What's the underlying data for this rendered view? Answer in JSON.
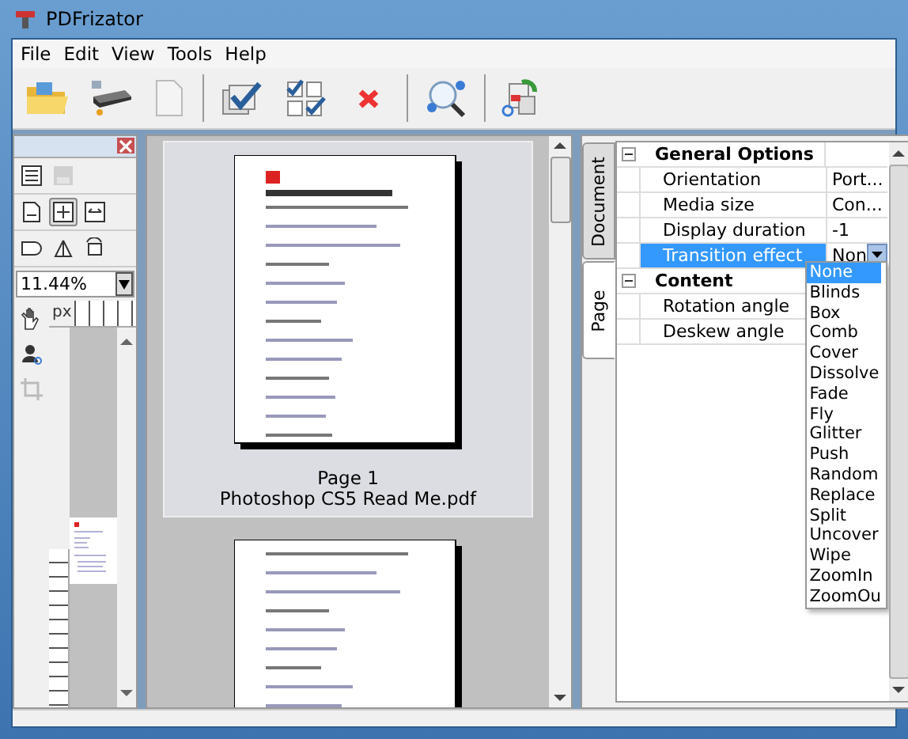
{
  "window": {
    "title": "PDFrizator"
  },
  "menu": [
    "File",
    "Edit",
    "View",
    "Tools",
    "Help"
  ],
  "left_panel": {
    "zoom": "11.44%",
    "ruler_unit": "px"
  },
  "pages": [
    {
      "label": "Page 1",
      "file": "Photoshop CS5 Read Me.pdf",
      "selected": true
    },
    {
      "selected": false
    }
  ],
  "side_tabs": [
    {
      "label": "Document",
      "selected": false
    },
    {
      "label": "Page",
      "selected": true
    }
  ],
  "property_groups": [
    {
      "name": "General Options",
      "expanded": true,
      "rows": [
        {
          "name": "Orientation",
          "value": "Port...",
          "selected": false
        },
        {
          "name": "Media size",
          "value": "Con...",
          "selected": false
        },
        {
          "name": "Display duration",
          "value": "-1",
          "selected": false
        },
        {
          "name": "Transition effect",
          "value": "Non",
          "selected": true
        }
      ]
    },
    {
      "name": "Content",
      "expanded": true,
      "rows": [
        {
          "name": "Rotation angle",
          "selected": false
        },
        {
          "name": "Deskew angle",
          "selected": false
        }
      ]
    }
  ],
  "dropdown": {
    "options": [
      {
        "label": "None",
        "selected": true
      },
      {
        "label": "Blinds",
        "selected": false
      },
      {
        "label": "Box",
        "selected": false
      },
      {
        "label": "Comb",
        "selected": false
      },
      {
        "label": "Cover",
        "selected": false
      },
      {
        "label": "Dissolve",
        "selected": false
      },
      {
        "label": "Fade",
        "selected": false
      },
      {
        "label": "Fly",
        "selected": false
      },
      {
        "label": "Glitter",
        "selected": false
      },
      {
        "label": "Push",
        "selected": false
      },
      {
        "label": "Random",
        "selected": false
      },
      {
        "label": "Replace",
        "selected": false
      },
      {
        "label": "Split",
        "selected": false
      },
      {
        "label": "Uncover",
        "selected": false
      },
      {
        "label": "Wipe",
        "selected": false
      },
      {
        "label": "ZoomIn",
        "selected": false
      },
      {
        "label": "ZoomOu",
        "selected": false
      }
    ]
  }
}
